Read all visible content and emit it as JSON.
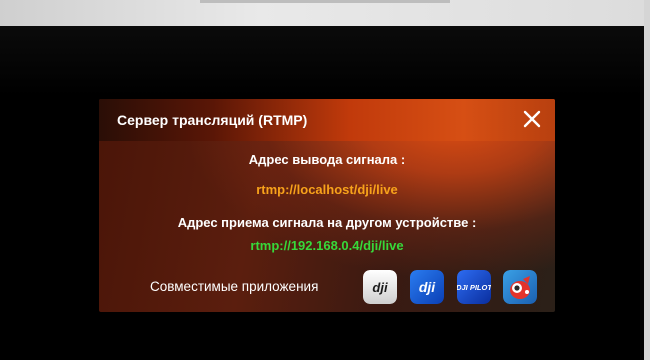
{
  "dialog": {
    "title": "Сервер трансляций (RTMP)",
    "output_label": "Адрес вывода сигнала :",
    "output_url": "rtmp://localhost/dji/live",
    "receive_label": "Адрес приема сигнала на другом устройстве :",
    "receive_url": "rtmp://192.168.0.4/dji/live",
    "compatible_label": "Совместимые приложения",
    "apps": [
      {
        "icon": "dji-go-icon",
        "text": "dji"
      },
      {
        "icon": "dji-go4-icon",
        "text": "dji"
      },
      {
        "icon": "dji-pilot-icon",
        "text": "DJI PILOT"
      },
      {
        "icon": "vlc-style-player-icon"
      }
    ]
  },
  "colors": {
    "accent": "#d64f14",
    "output_url": "#f7a21b",
    "receive_url": "#37d83a"
  }
}
